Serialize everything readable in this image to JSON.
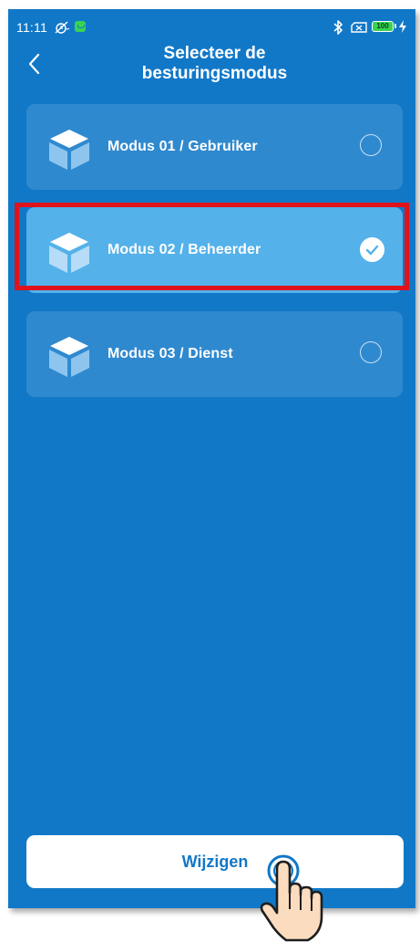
{
  "status_bar": {
    "time": "11:11",
    "battery": "100",
    "icons": [
      "alarm-off-icon",
      "app-notification-icon",
      "bluetooth-icon",
      "no-sim-icon",
      "battery-icon",
      "charging-icon"
    ]
  },
  "header": {
    "title": "Selecteer de besturingsmodus",
    "back_icon": "chevron-left-icon"
  },
  "modes": [
    {
      "label": "Modus 01 / Gebruiker",
      "selected": false,
      "icon": "cube-icon"
    },
    {
      "label": "Modus 02 / Beheerder",
      "selected": true,
      "icon": "cube-icon"
    },
    {
      "label": "Modus 03 / Dienst",
      "selected": false,
      "icon": "cube-icon"
    }
  ],
  "footer": {
    "change_label": "Wijzigen"
  },
  "colors": {
    "background": "#1178c8",
    "selected_row": "#54b1ea",
    "highlight_border": "#e0121b",
    "button_text": "#1178c8"
  }
}
